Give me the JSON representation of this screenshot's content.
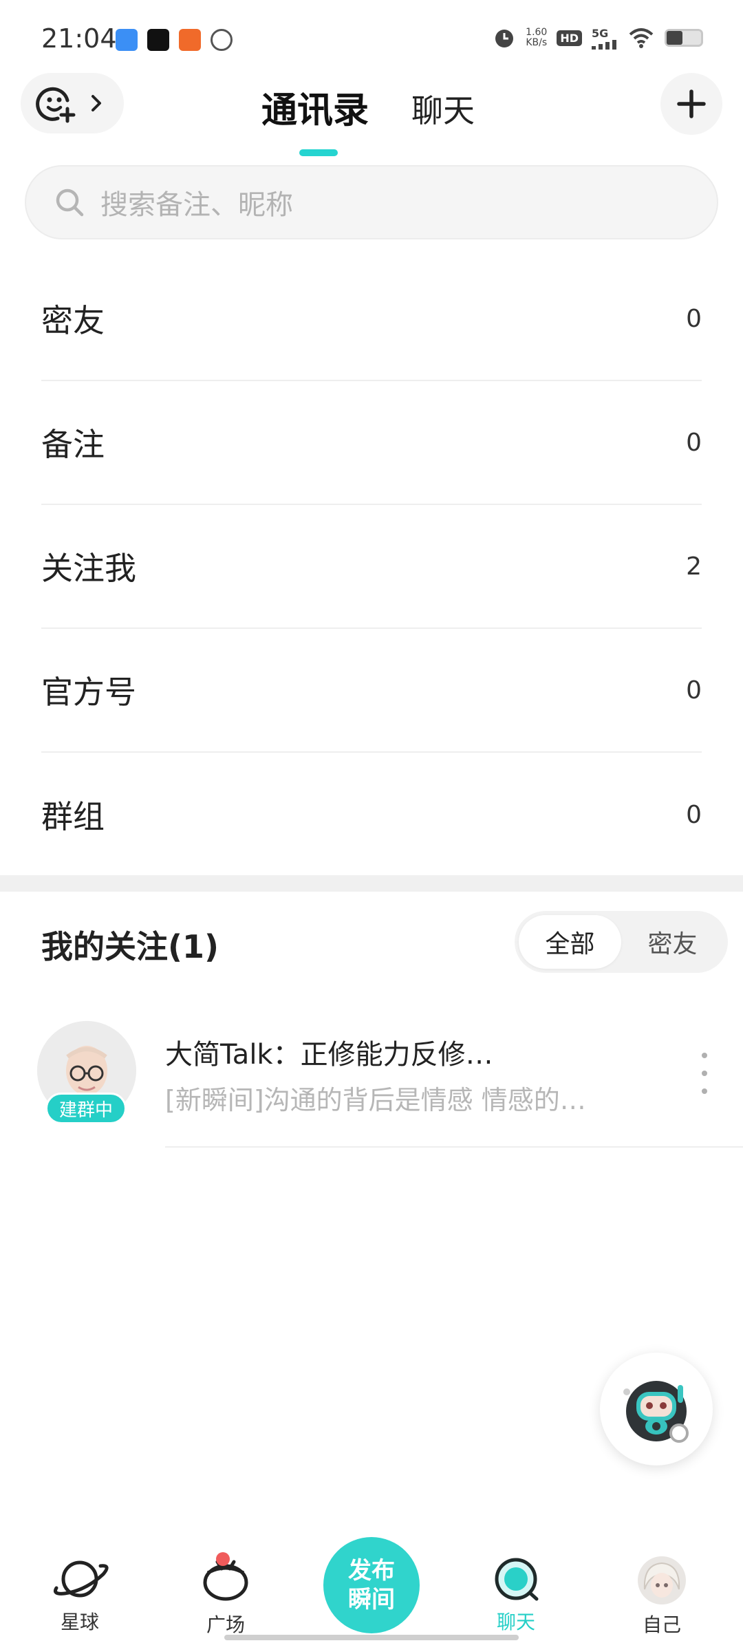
{
  "status_bar": {
    "time": "21:04",
    "net_speed_value": "1.60",
    "net_speed_unit": "KB/s",
    "hd": "HD",
    "network": "5G",
    "icons": [
      "app-notification-icon",
      "soul-app-icon",
      "app-icon",
      "planet-app-icon",
      "alarm-icon",
      "signal-icon",
      "wifi-icon",
      "battery-icon"
    ]
  },
  "header": {
    "tabs": [
      {
        "label": "通讯录",
        "active": true
      },
      {
        "label": "聊天",
        "active": false
      }
    ],
    "accent_color": "#25d4d0"
  },
  "search": {
    "placeholder": "搜索备注、昵称"
  },
  "contacts": [
    {
      "label": "密友",
      "count": "0"
    },
    {
      "label": "备注",
      "count": "0"
    },
    {
      "label": "关注我",
      "count": "2"
    },
    {
      "label": "官方号",
      "count": "0"
    },
    {
      "label": "群组",
      "count": "0"
    }
  ],
  "following": {
    "title": "我的关注(1)",
    "filters": [
      {
        "label": "全部",
        "active": true
      },
      {
        "label": "密友",
        "active": false
      }
    ],
    "items": [
      {
        "name": "大简Talk：正修能力反修…",
        "message": "[新瞬间]沟通的背后是情感 情感的…",
        "badge": "建群中"
      }
    ]
  },
  "bottom_nav": {
    "items": [
      {
        "label": "星球",
        "icon": "planet-icon"
      },
      {
        "label": "广场",
        "icon": "square-icon"
      },
      {
        "label": "聊天",
        "icon": "chat-icon",
        "active": true
      },
      {
        "label": "自己",
        "icon": "avatar-icon"
      }
    ],
    "publish": {
      "line1": "发布",
      "line2": "瞬间"
    }
  }
}
